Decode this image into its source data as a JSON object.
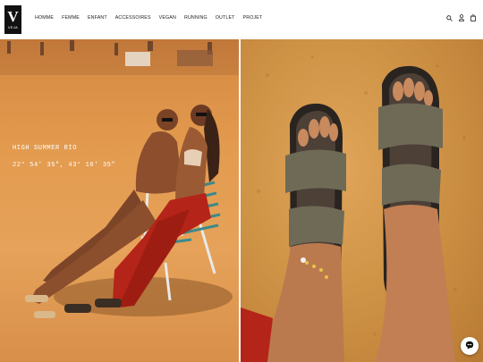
{
  "brand": {
    "logo_letter": "V",
    "logo_word": "VEJA"
  },
  "nav": {
    "items": [
      "HOMME",
      "FEMME",
      "ENFANT",
      "ACCESSOIRES",
      "VEGAN",
      "RUNNING",
      "OUTLET",
      "PROJET"
    ]
  },
  "header_icons": [
    "search-icon",
    "user-icon",
    "bag-icon"
  ],
  "hero": {
    "title": "HIGH SUMMER RIO",
    "coordinates": "22° 54' 35\", 43° 10' 35\""
  },
  "colors": {
    "logo_bg": "#111111",
    "sand": "#e39b4f",
    "sandal": "#6f6a56",
    "red_fabric": "#b52418"
  },
  "chat": {
    "icon": "chat-icon"
  }
}
